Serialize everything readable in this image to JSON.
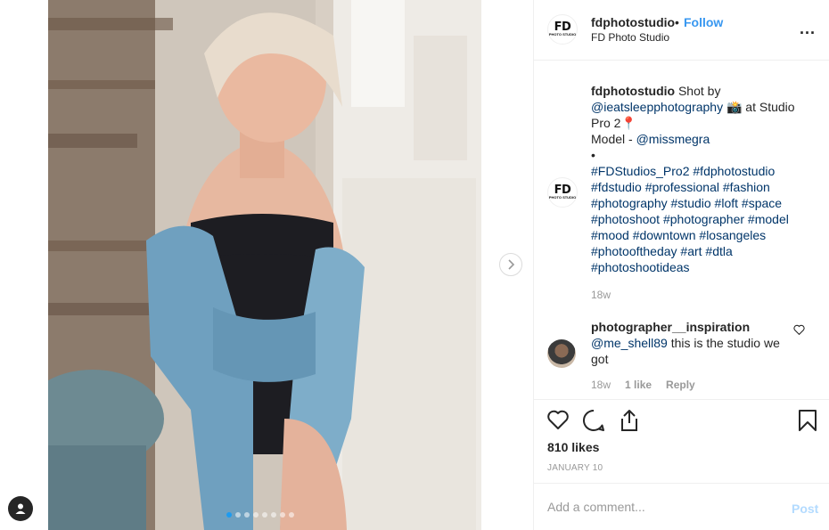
{
  "header": {
    "username": "fdphotostudio",
    "separator": "•",
    "follow_label": "Follow",
    "subtitle": "FD Photo Studio",
    "more_label": "..."
  },
  "avatar": {
    "line1": "FD",
    "line2": "PHOTO STUDIO"
  },
  "caption": {
    "username": "fdphotostudio",
    "text1": " Shot by ",
    "mention1": "@ieatsleepphotography",
    "text2": " 📸 at Studio Pro 2📍",
    "model_prefix": "Model - ",
    "mention2": "@missmegra",
    "bullet": "•",
    "hashtags": "#FDStudios_Pro2 #fdphotostudio #fdstudio #professional #fashion #photography #studio #loft #space #photoshoot #photographer #model #mood #downtown #losangeles #photooftheday #art #dtla #photoshootideas",
    "time": "18w"
  },
  "comment": {
    "username": "photographer__inspiration",
    "mention": "@me_shell89",
    "text": " this is the studio we got",
    "time": "18w",
    "likes": "1 like",
    "reply": "Reply"
  },
  "actions": {
    "icons": [
      "heart-icon",
      "comment-icon",
      "share-icon",
      "bookmark-icon"
    ],
    "likes": "810 likes",
    "date": "JANUARY 10"
  },
  "add_comment": {
    "placeholder": "Add a comment...",
    "post_label": "Post"
  },
  "carousel": {
    "total": 8,
    "active": 1
  },
  "colors": {
    "link": "#003569",
    "follow": "#3897f0",
    "muted": "#999999",
    "post_disabled": "#b3dbff"
  }
}
